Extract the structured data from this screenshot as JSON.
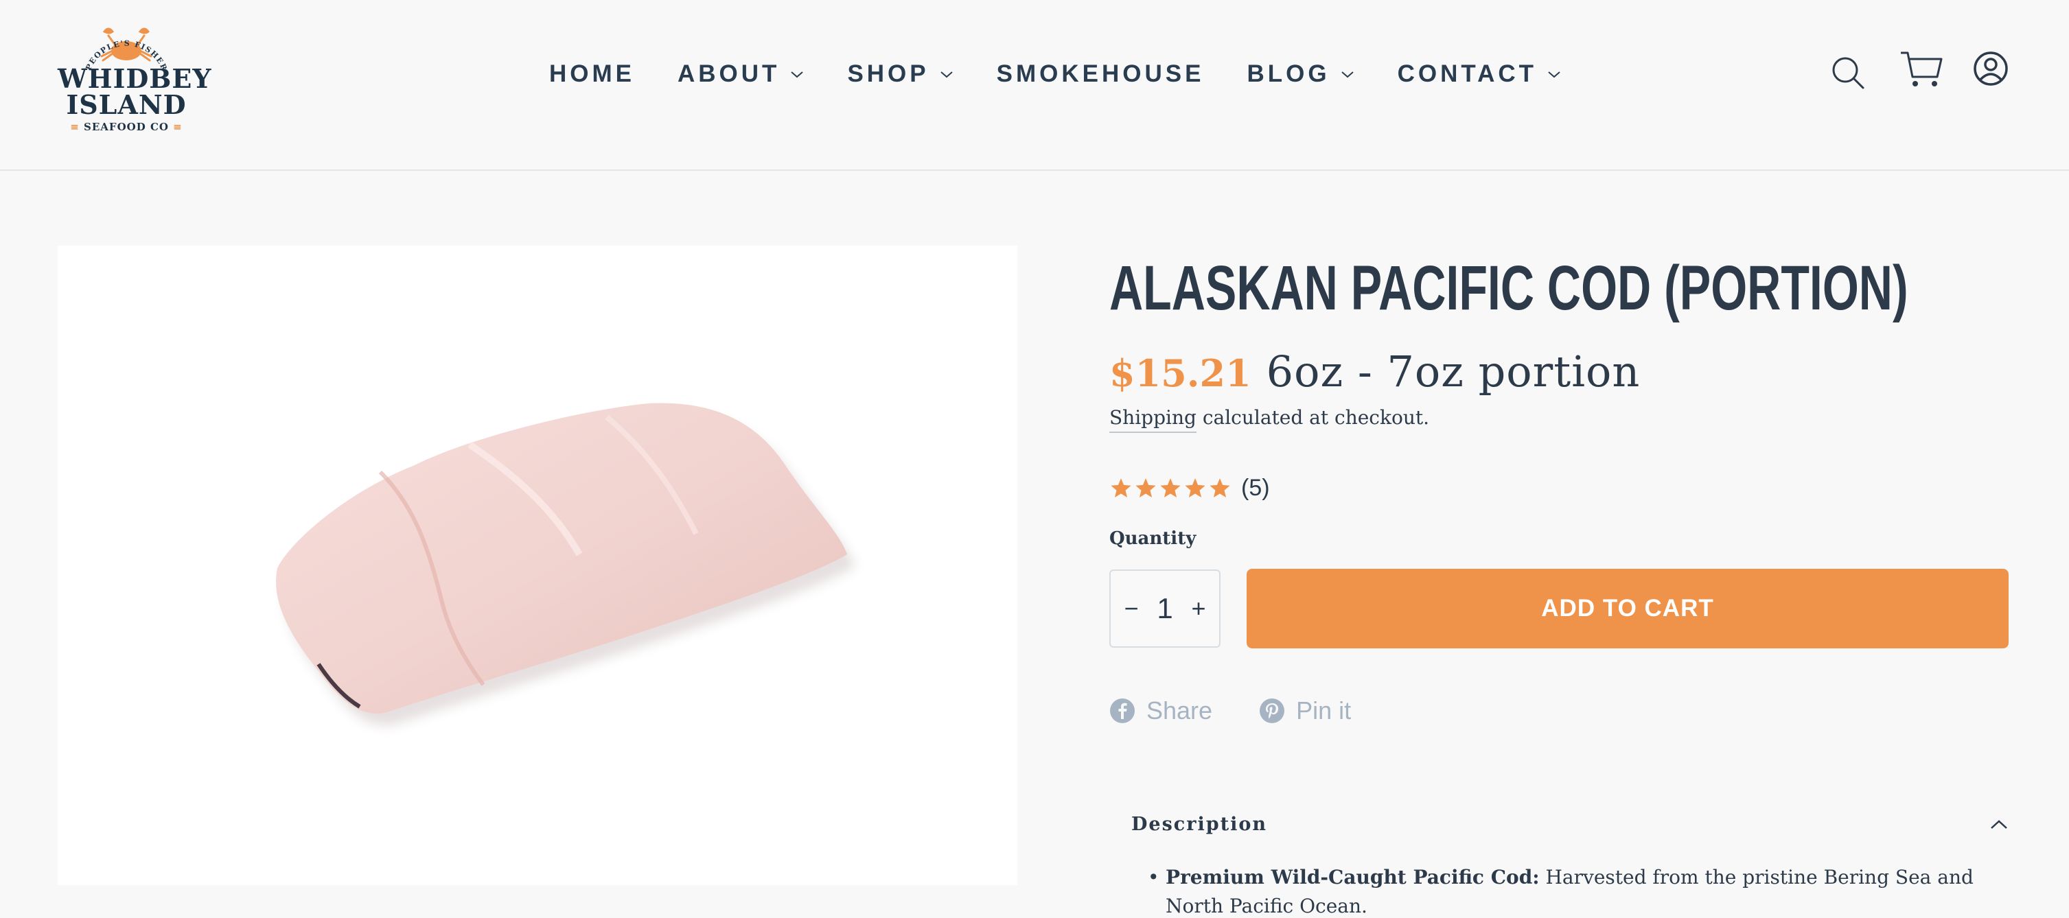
{
  "brand": {
    "arc_text": "THE PEOPLE'S FISHERMAN",
    "line1": "WHIDBEY",
    "line2": "ISLAND",
    "line3": "SEAFOOD CO",
    "accent_color": "#f0934a",
    "dark_color": "#1f3347"
  },
  "nav": {
    "items": [
      {
        "label": "HOME",
        "has_dropdown": false
      },
      {
        "label": "ABOUT",
        "has_dropdown": true
      },
      {
        "label": "SHOP",
        "has_dropdown": true
      },
      {
        "label": "SMOKEHOUSE",
        "has_dropdown": false
      },
      {
        "label": "BLOG",
        "has_dropdown": true
      },
      {
        "label": "CONTACT",
        "has_dropdown": true
      }
    ]
  },
  "header_icons": [
    "search-icon",
    "cart-icon",
    "account-icon"
  ],
  "product": {
    "title": "ALASKAN PACIFIC COD (PORTION)",
    "price": "$15.21",
    "variant": "6oz - 7oz portion",
    "shipping_link": "Shipping",
    "shipping_rest": " calculated at checkout.",
    "rating_stars": 5,
    "rating_count": "(5)",
    "quantity_label": "Quantity",
    "quantity_value": "1",
    "qty_minus": "−",
    "qty_plus": "+",
    "add_to_cart": "ADD TO CART"
  },
  "share": {
    "facebook": "Share",
    "pinterest": "Pin it"
  },
  "description": {
    "title": "Description",
    "bullet_bold": "Premium Wild-Caught Pacific Cod:",
    "bullet_text": " Harvested from the pristine Bering Sea and North Pacific Ocean."
  },
  "colors": {
    "accent": "#f0934a",
    "text": "#2c3a4a",
    "muted": "#a6b3c2",
    "background": "#f8f8f8"
  }
}
